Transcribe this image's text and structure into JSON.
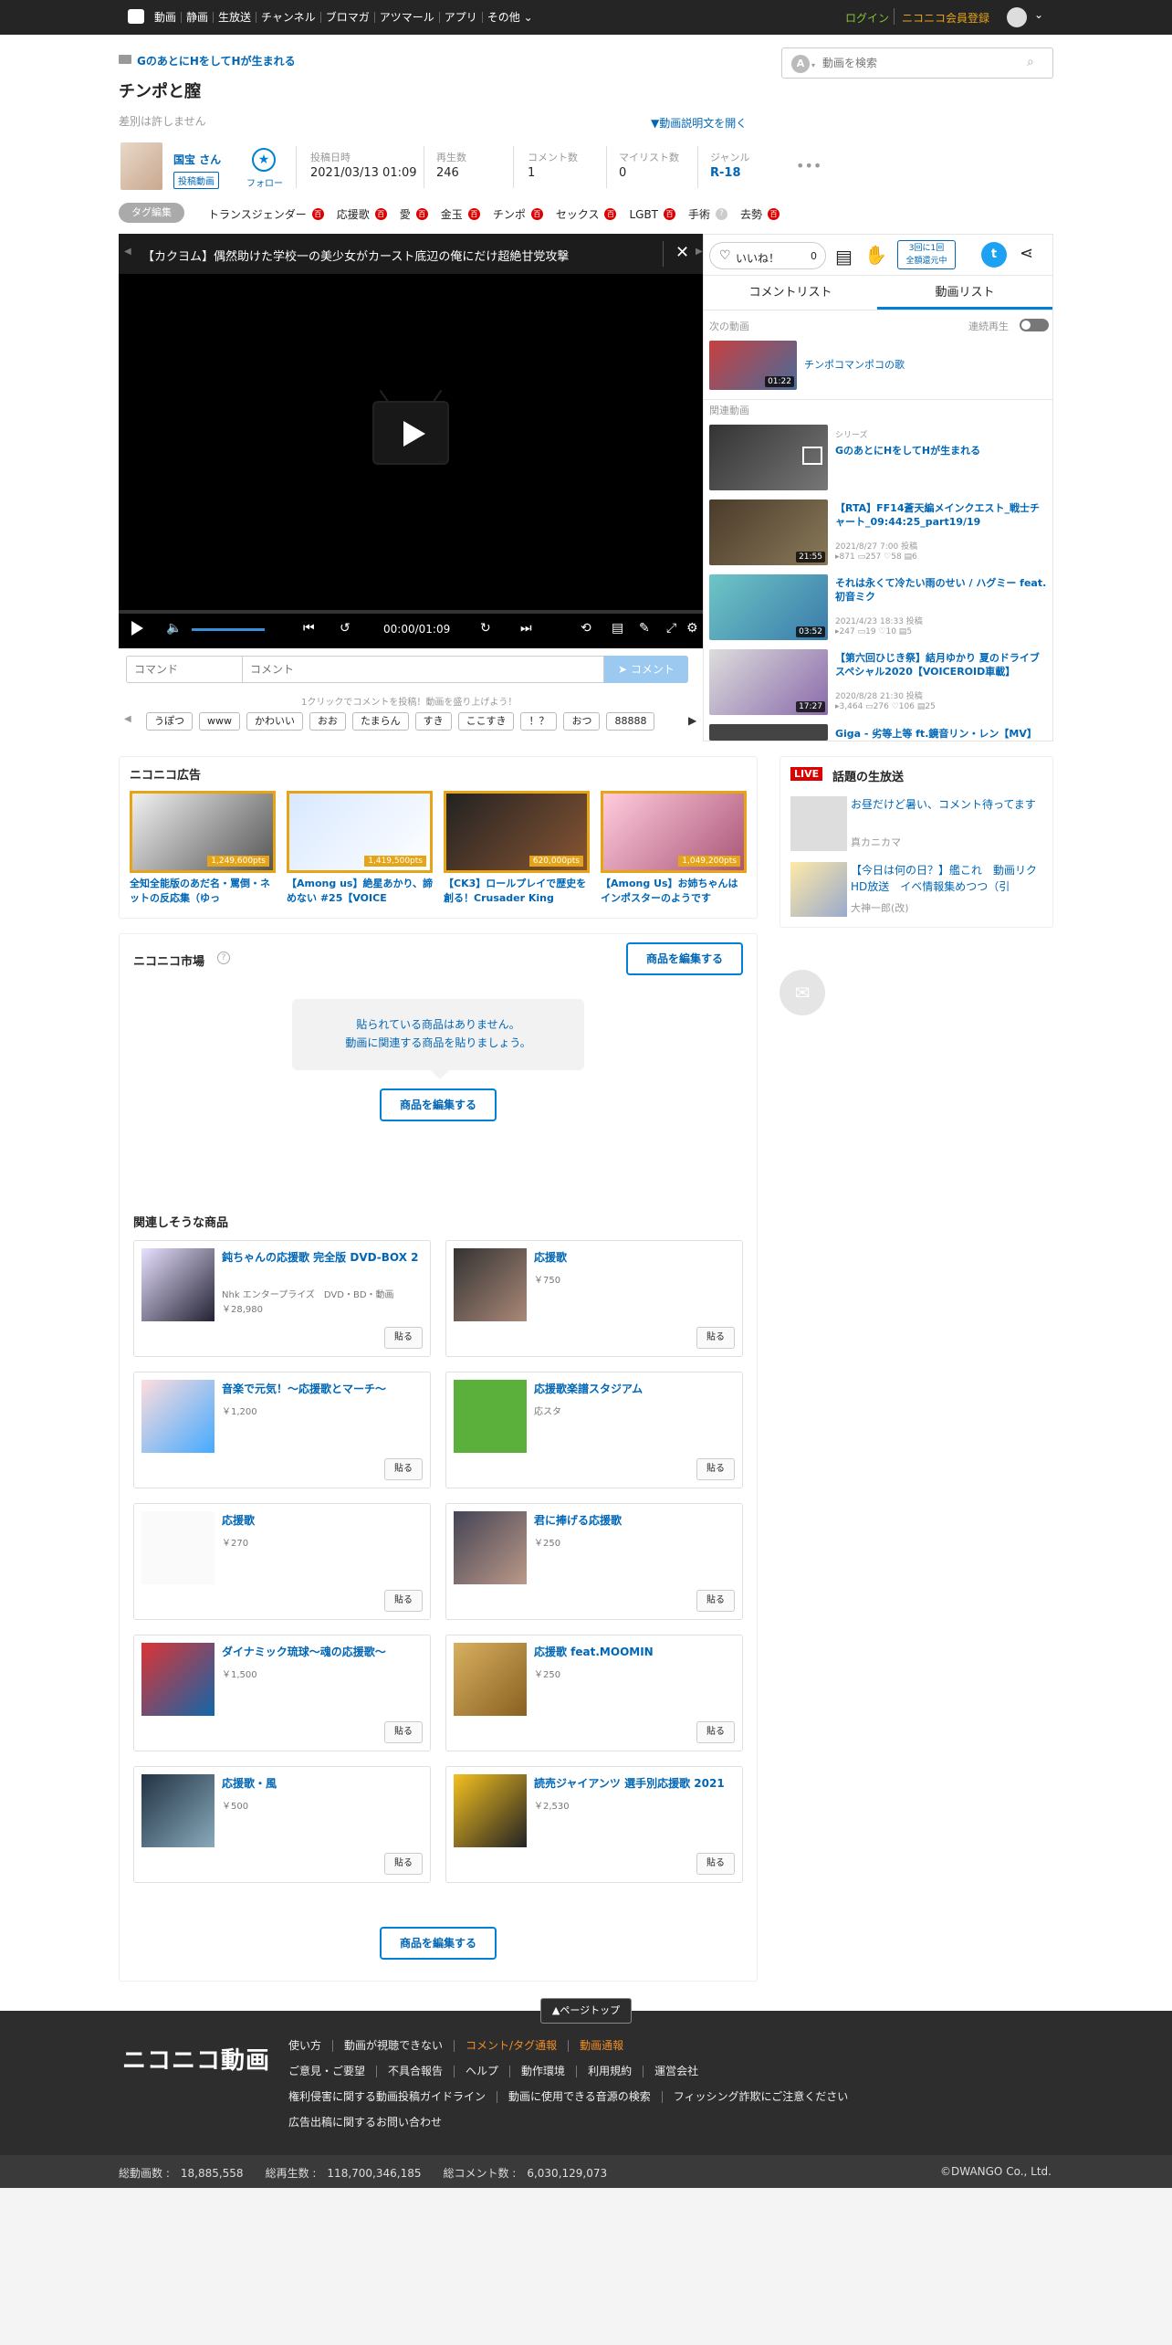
{
  "nav": {
    "items": [
      "動画",
      "静画",
      "生放送",
      "チャンネル",
      "ブロマガ",
      "アツマール",
      "アプリ",
      "その他"
    ],
    "login": "ログイン",
    "register": "ニコニコ会員登録",
    "search_placeholder": "動画を検索",
    "search_mode": "A"
  },
  "video": {
    "series": "GのあとにHをしてHが生まれる",
    "title": "チンポと膣",
    "desc": "差別は許しません",
    "desc_toggle": "▼動画説明文を開く",
    "uploader": "国宝 さん",
    "uploader_badge": "投稿動画",
    "follow": "フォロー",
    "stats": [
      {
        "label": "投稿日時",
        "value": "2021/03/13 01:09"
      },
      {
        "label": "再生数",
        "value": "246"
      },
      {
        "label": "コメント数",
        "value": "1"
      },
      {
        "label": "マイリスト数",
        "value": "0"
      },
      {
        "label": "ジャンル",
        "value": "R-18"
      }
    ],
    "more": "•••",
    "tag_edit": "タグ編集",
    "tags": [
      {
        "t": "トランスジェンダー",
        "b": "百"
      },
      {
        "t": "応援歌",
        "b": "百"
      },
      {
        "t": "愛",
        "b": "百"
      },
      {
        "t": "金玉",
        "b": "百"
      },
      {
        "t": "チンポ",
        "b": "百"
      },
      {
        "t": "セックス",
        "b": "百"
      },
      {
        "t": "LGBT",
        "b": "百"
      },
      {
        "t": "手術",
        "b": "?"
      },
      {
        "t": "去勢",
        "b": "百"
      }
    ]
  },
  "player": {
    "ticker": "【カクヨム】偶然助けた学校一の美少女がカースト底辺の俺にだけ超絶甘党攻撃",
    "time": "00:00/01:09",
    "cmd_placeholder": "コマンド",
    "comment_placeholder": "コメント",
    "comment_btn": "コメント",
    "hint": "1クリックでコメントを投稿！動画を盛り上げよう！",
    "quick": [
      "うぽつ",
      "www",
      "かわいい",
      "おお",
      "たまらん",
      "すき",
      "ここすき",
      "！？",
      "おつ",
      "88888"
    ]
  },
  "side": {
    "like": "いいね！",
    "like_count": "0",
    "repeat": "3回に1回\n全額還元中",
    "tab_comments": "コメントリスト",
    "tab_videos": "動画リスト",
    "next_label": "次の動画",
    "autoplay": "連続再生",
    "next": {
      "title": "チンポコマンポコの歌",
      "dur": "01:22"
    },
    "related_label": "関連動画",
    "related": [
      {
        "series": "シリーズ",
        "title": "GのあとにHをしてHが生まれる",
        "dur": ""
      },
      {
        "title": "【RTA】FF14蒼天編メインクエスト_戦士チャート_09:44:25_part19/19",
        "dur": "21:55",
        "date": "2021/8/27 7:00 投稿",
        "v": "871",
        "c": "257",
        "m": "58",
        "l": "6"
      },
      {
        "title": "それは永くて冷たい雨のせい / ハグミー feat. 初音ミク",
        "dur": "03:52",
        "date": "2021/4/23 18:33 投稿",
        "v": "247",
        "c": "19",
        "m": "10",
        "l": "5"
      },
      {
        "title": "【第六回ひじき祭】結月ゆかり 夏のドライブスペシャル2020【VOICEROID車載】",
        "dur": "17:27",
        "date": "2020/8/28 21:30 投稿",
        "v": "3,464",
        "c": "276",
        "m": "106",
        "l": "25"
      },
      {
        "title": "Giga - 劣等上等 ft.鏡音リン・レン【MV】",
        "dur": ""
      }
    ]
  },
  "ads": {
    "title": "ニコニコ広告",
    "items": [
      {
        "pts": "1,249,600pts",
        "t": "全知全能版のあだ名・罵倒・ネットの反応集（ゆっ"
      },
      {
        "pts": "1,419,500pts",
        "t": "【Among us】絶星あかり、諦めない #25【VOICE"
      },
      {
        "pts": "620,000pts",
        "t": "【CK3】ロールプレイで歴史を創る！Crusader King"
      },
      {
        "pts": "1,049,200pts",
        "t": "【Among Us】お姉ちゃんはインポスターのようです"
      }
    ]
  },
  "live": {
    "badge": "LIVE",
    "title": "話題の生放送",
    "items": [
      {
        "t": "お昼だけど暑い、コメント待ってます",
        "s": "真カニカマ"
      },
      {
        "t": "【今日は何の日？】艦これ　動画リクHD放送　イベ情報集めつつ（引",
        "s": "大神一郎(改)"
      }
    ]
  },
  "market": {
    "title": "ニコニコ市場",
    "edit": "商品を編集する",
    "empty1": "貼られている商品はありません。",
    "empty2": "動画に関連する商品を貼りましょう。",
    "related": "関連しそうな商品",
    "paste": "貼る",
    "products": [
      {
        "n": "鈍ちゃんの応援歌 完全版 DVD-BOX 2",
        "m": "Nhk エンタープライズ　DVD・BD・動画",
        "p": "￥28,980"
      },
      {
        "n": "応援歌",
        "m": "",
        "p": "￥750"
      },
      {
        "n": "音楽で元気！～応援歌とマーチ～",
        "m": "",
        "p": "￥1,200"
      },
      {
        "n": "応援歌楽譜スタジアム",
        "m": "応スタ",
        "p": ""
      },
      {
        "n": "応援歌",
        "m": "",
        "p": "￥270"
      },
      {
        "n": "君に捧げる応援歌",
        "m": "",
        "p": "￥250"
      },
      {
        "n": "ダイナミック琉球～魂の応援歌～",
        "m": "",
        "p": "￥1,500"
      },
      {
        "n": "応援歌 feat.MOOMIN",
        "m": "",
        "p": "￥250"
      },
      {
        "n": "応援歌・風",
        "m": "",
        "p": "￥500"
      },
      {
        "n": "読売ジャイアンツ 選手別応援歌 2021",
        "m": "",
        "p": "￥2,530"
      }
    ]
  },
  "footer": {
    "pagetop": "▲ページトップ",
    "logo": "ニコニコ動画",
    "row1": [
      "使い方",
      "動画が視聴できない",
      "コメント/タグ通報",
      "動画通報"
    ],
    "row2": [
      "ご意見・ご要望",
      "不具合報告",
      "ヘルプ",
      "動作環境",
      "利用規約",
      "運営会社"
    ],
    "row3": [
      "権利侵害に関する動画投稿ガイドライン",
      "動画に使用できる音源の検索",
      "フィッシング詐欺にご注意ください"
    ],
    "row4": [
      "広告出稿に関するお問い合わせ"
    ],
    "stats": "総動画数 :　18,885,558　　総再生数 :　118,700,346,185　　総コメント数 :　6,030,129,073",
    "copy": "©DWANGO Co., Ltd."
  }
}
